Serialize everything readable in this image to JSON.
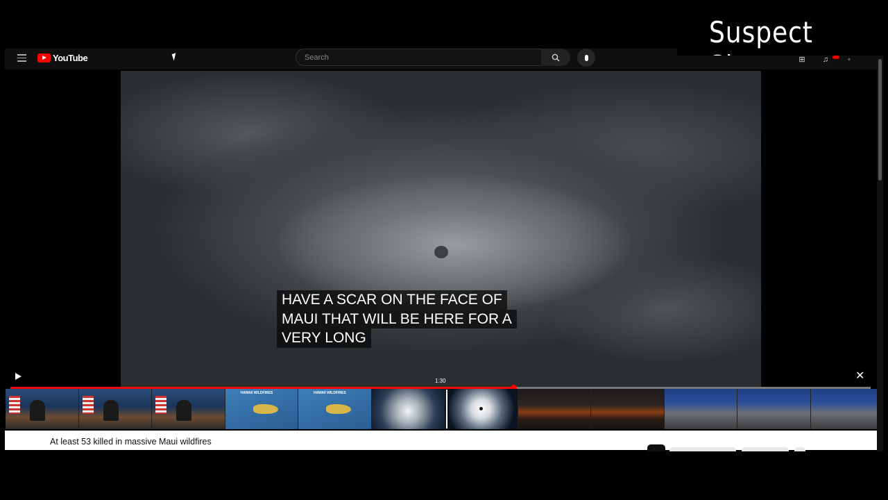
{
  "watermark": "Suspect Sky",
  "header": {
    "logo_text": "YouTube",
    "search_placeholder": "Search"
  },
  "player": {
    "caption_lines": [
      "HAVE A SCAR ON THE FACE OF",
      "MAUI THAT WILL BE HERE FOR A",
      "VERY LONG"
    ],
    "hover_time": "1:30",
    "progress_fraction": 0.585,
    "play_icon": "play-icon",
    "close_icon": "close-icon",
    "thumbnail_labels": [
      "HAWAII WILDFIRES",
      "HAWAII WILDFIRES"
    ]
  },
  "video": {
    "title": "At least 53 killed in massive Maui wildfires"
  },
  "colors": {
    "brand_red": "#ff0000",
    "background": "#000000"
  }
}
